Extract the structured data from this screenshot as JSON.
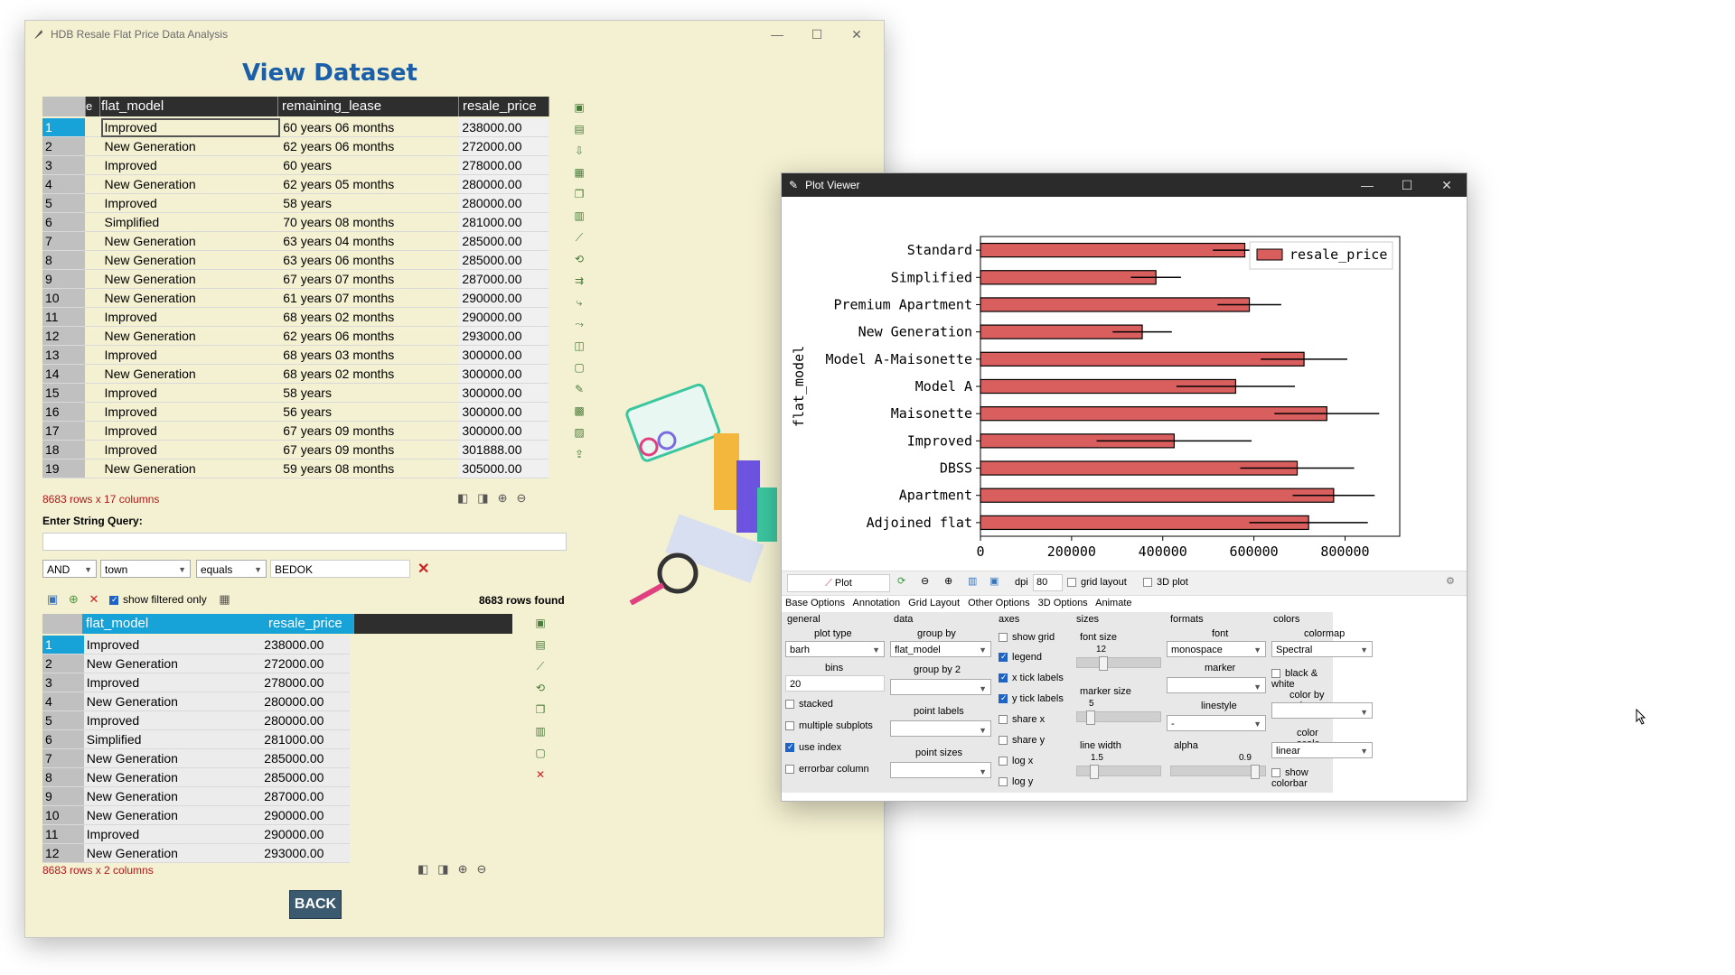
{
  "main_window": {
    "title": "HDB Resale Flat Price Data Analysis",
    "heading": "View Dataset",
    "table": {
      "columns": [
        "e",
        "flat_model",
        "remaining_lease",
        "resale_price"
      ],
      "rows": [
        [
          "1",
          "Improved",
          "60 years 06 months",
          "238000.00"
        ],
        [
          "2",
          "New Generation",
          "62 years 06 months",
          "272000.00"
        ],
        [
          "3",
          "Improved",
          "60 years",
          "278000.00"
        ],
        [
          "4",
          "New Generation",
          "62 years 05 months",
          "280000.00"
        ],
        [
          "5",
          "Improved",
          "58 years",
          "280000.00"
        ],
        [
          "6",
          "Simplified",
          "70 years 08 months",
          "281000.00"
        ],
        [
          "7",
          "New Generation",
          "63 years 04 months",
          "285000.00"
        ],
        [
          "8",
          "New Generation",
          "63 years 06 months",
          "285000.00"
        ],
        [
          "9",
          "New Generation",
          "67 years 07 months",
          "287000.00"
        ],
        [
          "10",
          "New Generation",
          "61 years 07 months",
          "290000.00"
        ],
        [
          "11",
          "Improved",
          "68 years 02 months",
          "290000.00"
        ],
        [
          "12",
          "New Generation",
          "62 years 06 months",
          "293000.00"
        ],
        [
          "13",
          "Improved",
          "68 years 03 months",
          "300000.00"
        ],
        [
          "14",
          "New Generation",
          "68 years 02 months",
          "300000.00"
        ],
        [
          "15",
          "Improved",
          "58 years",
          "300000.00"
        ],
        [
          "16",
          "Improved",
          "56 years",
          "300000.00"
        ],
        [
          "17",
          "Improved",
          "67 years 09 months",
          "300000.00"
        ],
        [
          "18",
          "Improved",
          "67 years 09 months",
          "301888.00"
        ],
        [
          "19",
          "New Generation",
          "59 years 08 months",
          "305000.00"
        ]
      ]
    },
    "table_status": "8683 rows x 17 columns",
    "query_label": "Enter String Query:",
    "filter": {
      "op": "AND",
      "field": "town",
      "cond": "equals",
      "value": "BEDOK"
    },
    "show_filtered_label": "show filtered only",
    "rows_found": "8683 rows found",
    "subtable": {
      "columns": [
        "flat_model",
        "resale_price"
      ],
      "rows": [
        [
          "1",
          "Improved",
          "238000.00"
        ],
        [
          "2",
          "New Generation",
          "272000.00"
        ],
        [
          "3",
          "Improved",
          "278000.00"
        ],
        [
          "4",
          "New Generation",
          "280000.00"
        ],
        [
          "5",
          "Improved",
          "280000.00"
        ],
        [
          "6",
          "Simplified",
          "281000.00"
        ],
        [
          "7",
          "New Generation",
          "285000.00"
        ],
        [
          "8",
          "New Generation",
          "285000.00"
        ],
        [
          "9",
          "New Generation",
          "287000.00"
        ],
        [
          "10",
          "New Generation",
          "290000.00"
        ],
        [
          "11",
          "Improved",
          "290000.00"
        ],
        [
          "12",
          "New Generation",
          "293000.00"
        ]
      ]
    },
    "sub_status": "8683 rows x 2 columns",
    "back_label": "BACK"
  },
  "plot_viewer": {
    "title": "Plot Viewer",
    "toolbar": {
      "plot_label": "Plot",
      "dpi_label": "dpi",
      "dpi_value": "80",
      "grid_layout_label": "grid layout",
      "plot3d_label": "3D plot"
    },
    "tabs": [
      "Base Options",
      "Annotation",
      "Grid Layout",
      "Other Options",
      "3D Options",
      "Animate"
    ],
    "sections": {
      "general": "general",
      "data": "data",
      "axes": "axes",
      "sizes": "sizes",
      "formats": "formats",
      "colors": "colors"
    },
    "general": {
      "plot_type_label": "plot type",
      "plot_type": "barh",
      "bins_label": "bins",
      "bins": "20",
      "stacked": "stacked",
      "multiple_subplots": "multiple subplots",
      "use_index": "use index",
      "errorbar_column": "errorbar column"
    },
    "data": {
      "group_by_label": "group by",
      "group_by": "flat_model",
      "group_by2_label": "group by 2",
      "point_labels_label": "point labels",
      "point_sizes_label": "point sizes"
    },
    "axes": {
      "show_grid": "show grid",
      "legend": "legend",
      "x_tick_labels": "x tick labels",
      "y_tick_labels": "y tick labels",
      "share_x": "share x",
      "share_y": "share y",
      "log_x": "log x",
      "log_y": "log y"
    },
    "sizes": {
      "font_size_label": "font size",
      "font_size": "12",
      "marker_size_label": "marker size",
      "marker_size": "5",
      "line_width_label": "line width",
      "line_width": "1.5"
    },
    "formats": {
      "font_label": "font",
      "font": "monospace",
      "marker_label": "marker",
      "linestyle_label": "linestyle",
      "linestyle": "-",
      "alpha_label": "alpha",
      "alpha": "0.9"
    },
    "colors": {
      "colormap_label": "colormap",
      "colormap": "Spectral",
      "bw_label": "black & white",
      "color_by_value_label": "color by value",
      "color_scale_label": "color scale",
      "color_scale": "linear",
      "show_colorbar": "show colorbar"
    }
  },
  "chart_data": {
    "type": "bar",
    "orientation": "horizontal",
    "categories": [
      "Standard",
      "Simplified",
      "Premium Apartment",
      "New Generation",
      "Model A-Maisonette",
      "Model A",
      "Maisonette",
      "Improved",
      "DBSS",
      "Apartment",
      "Adjoined flat"
    ],
    "series": [
      {
        "name": "resale_price",
        "values": [
          580000,
          385000,
          590000,
          355000,
          710000,
          560000,
          760000,
          425000,
          695000,
          775000,
          720000
        ]
      }
    ],
    "errors": [
      70000,
      55000,
      70000,
      65000,
      95000,
      130000,
      115000,
      170000,
      125000,
      90000,
      130000
    ],
    "xlabel": "",
    "ylabel": "flat_model",
    "xticks": [
      "0",
      "200000",
      "400000",
      "600000",
      "800000"
    ],
    "xlim": [
      0,
      920000
    ],
    "bar_color": "#d95f5f",
    "legend_position": "top-right",
    "grid": false
  }
}
